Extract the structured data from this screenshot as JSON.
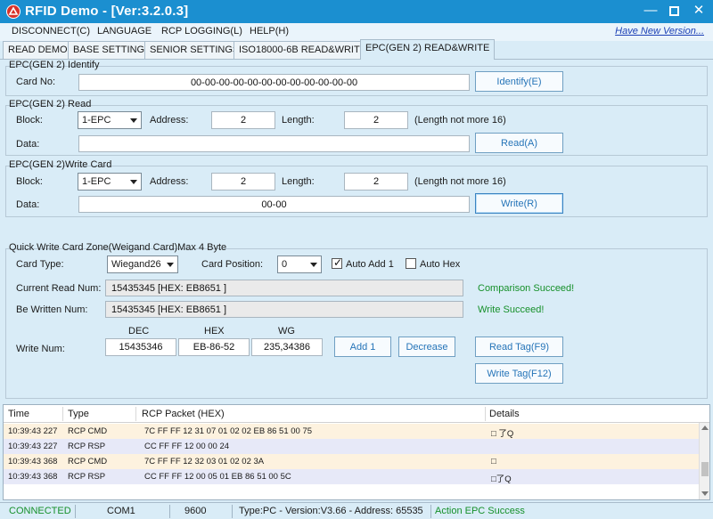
{
  "window": {
    "title": "RFID Demo - [Ver:3.2.0.3]",
    "min_icon": "minimize-icon",
    "max_icon": "maximize-icon",
    "close_icon": "close-icon"
  },
  "menu": {
    "items": [
      "DISCONNECT(C)",
      "LANGUAGE",
      "RCP LOGGING(L)",
      "HELP(H)"
    ],
    "new_version": "Have New Version..."
  },
  "tabs": [
    "READ DEMO",
    "BASE SETTINGS",
    "SENIOR SETTINGS",
    "ISO18000-6B READ&WRITE",
    "EPC(GEN 2) READ&WRITE"
  ],
  "identify": {
    "title": "EPC(GEN 2) Identify",
    "card_no_label": "Card No:",
    "card_no_value": "00-00-00-00-00-00-00-00-00-00-00-00",
    "button": "Identify(E)"
  },
  "read": {
    "title": "EPC(GEN 2) Read",
    "block_label": "Block:",
    "block_value": "1-EPC",
    "address_label": "Address:",
    "address_value": "2",
    "length_label": "Length:",
    "length_value": "2",
    "length_note": "(Length not more 16)",
    "data_label": "Data:",
    "data_value": "",
    "button": "Read(A)"
  },
  "write": {
    "title": "EPC(GEN 2)Write Card",
    "block_label": "Block:",
    "block_value": "1-EPC",
    "address_label": "Address:",
    "address_value": "2",
    "length_label": "Length:",
    "length_value": "2",
    "length_note": "(Length not more 16)",
    "data_label": "Data:",
    "data_value": "00-00",
    "button": "Write(R)"
  },
  "quick": {
    "title": "Quick Write Card Zone(Weigand Card)Max 4 Byte",
    "card_type_label": "Card Type:",
    "card_type_value": "Wiegand26",
    "card_position_label": "Card Position:",
    "card_position_value": "0",
    "auto_add_label": "Auto Add 1",
    "auto_add_checked": true,
    "auto_hex_label": "Auto Hex",
    "auto_hex_checked": false,
    "current_read_label": "Current Read Num:",
    "current_read_value": "15435345 [HEX: EB8651 ]",
    "comparison_status": "Comparison Succeed!",
    "be_written_label": "Be Written Num:",
    "be_written_value": "15435345 [HEX: EB8651 ]",
    "write_status": "Write Succeed!",
    "col_dec": "DEC",
    "col_hex": "HEX",
    "col_wg": "WG",
    "write_num_label": "Write Num:",
    "dec_value": "15435346",
    "hex_value": "EB-86-52",
    "wg_value": "235,34386",
    "add_button": "Add 1",
    "decrease_button": "Decrease",
    "read_tag_button": "Read Tag(F9)",
    "write_tag_button": "Write Tag(F12)"
  },
  "log": {
    "columns": [
      "Time",
      "Type",
      "RCP Packet (HEX)",
      "Details"
    ],
    "rows": [
      {
        "time": "10:39:43 227",
        "type": "RCP CMD",
        "packet": "7C FF FF 12 31 07 01 02 02 EB 86 51 00 75",
        "details": "□  了Q"
      },
      {
        "time": "10:39:43 227",
        "type": "RCP RSP",
        "packet": "CC FF FF 12 00 00 24",
        "details": ""
      },
      {
        "time": "10:39:43 368",
        "type": "RCP CMD",
        "packet": "7C FF FF 12 32 03 01 02 02 3A",
        "details": "□"
      },
      {
        "time": "10:39:43 368",
        "type": "RCP RSP",
        "packet": "CC FF FF 12 00 05 01 EB 86 51 00 5C",
        "details": "□了Q"
      }
    ]
  },
  "status": {
    "connection": "CONNECTED",
    "port": "COM1",
    "baud": "9600",
    "device": "Type:PC - Version:V3.66 - Address: 65535",
    "action": "Action EPC Success"
  },
  "colors": {
    "titlebar": "#1b8fd0",
    "background": "#d9ecf7",
    "success_green": "#16902a",
    "log_odd_row": "#fdf2df",
    "log_even_row": "#e7e9f8"
  }
}
